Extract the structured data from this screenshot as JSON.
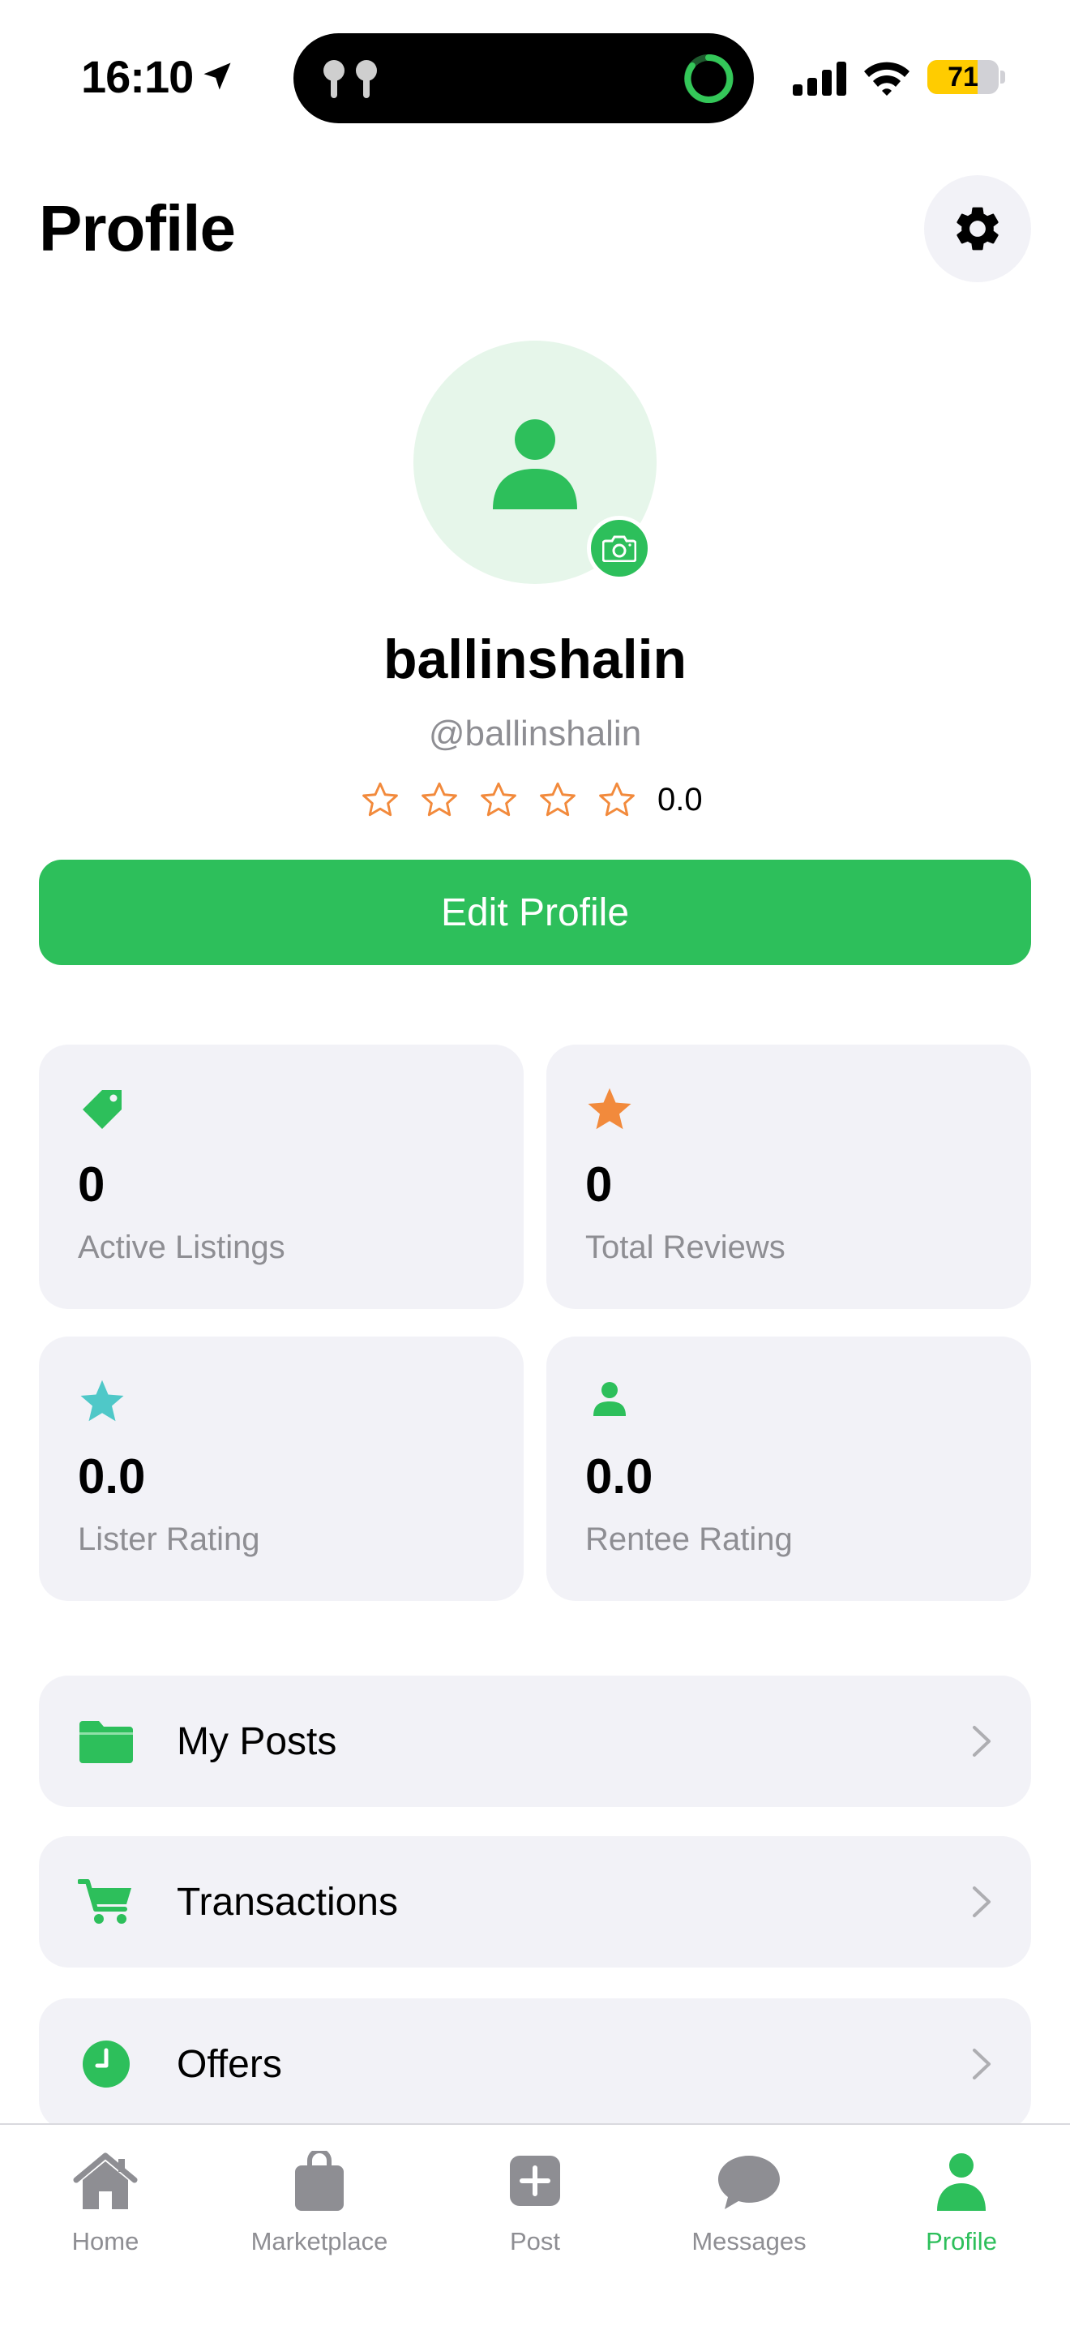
{
  "status_bar": {
    "time": "16:10",
    "battery": "71",
    "battery_level": 0.71
  },
  "header": {
    "title": "Profile"
  },
  "profile": {
    "display_name": "ballinshalin",
    "handle": "@ballinshalin",
    "rating": "0.0",
    "rating_stars_filled": 0,
    "edit_button": "Edit Profile"
  },
  "stats": [
    {
      "icon": "tag-icon",
      "value": "0",
      "label": "Active Listings"
    },
    {
      "icon": "star-icon",
      "value": "0",
      "label": "Total Reviews"
    },
    {
      "icon": "star-icon",
      "value": "0.0",
      "label": "Lister Rating"
    },
    {
      "icon": "person-icon",
      "value": "0.0",
      "label": "Rentee Rating"
    }
  ],
  "menu": [
    {
      "icon": "folder-icon",
      "label": "My Posts"
    },
    {
      "icon": "cart-icon",
      "label": "Transactions"
    },
    {
      "icon": "clock-icon",
      "label": "Offers"
    }
  ],
  "tabs": [
    {
      "icon": "house-icon",
      "label": "Home"
    },
    {
      "icon": "bag-icon",
      "label": "Marketplace"
    },
    {
      "icon": "plus-square-icon",
      "label": "Post"
    },
    {
      "icon": "chat-bubble-icon",
      "label": "Messages"
    },
    {
      "icon": "person-icon",
      "label": "Profile",
      "active": true
    }
  ],
  "colors": {
    "accent": "#2dbf5b",
    "star_outline": "#f28a3c",
    "card_bg": "#f2f2f7",
    "secondary_text": "#8e8e93",
    "teal": "#4fc8c8"
  }
}
